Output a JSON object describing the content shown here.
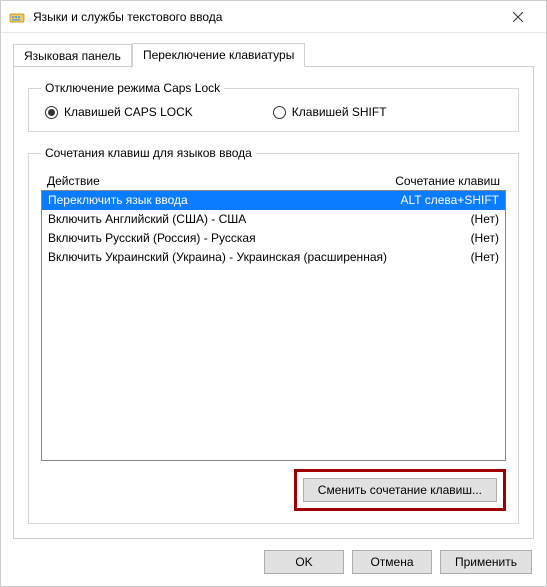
{
  "window": {
    "title": "Языки и службы текстового ввода"
  },
  "tabs": {
    "lang_panel": "Языковая панель",
    "kbd_switch": "Переключение клавиатуры"
  },
  "capslock_group": {
    "legend": "Отключение режима Caps Lock",
    "opt_caps": "Клавишей CAPS LOCK",
    "opt_shift": "Клавишей SHIFT"
  },
  "hotkeys_group": {
    "legend": "Сочетания клавиш для языков ввода",
    "col_action": "Действие",
    "col_combo": "Сочетание клавиш",
    "rows": [
      {
        "action": "Переключить язык ввода",
        "combo": "ALT слева+SHIFT",
        "selected": true
      },
      {
        "action": "Включить Английский (США) - США",
        "combo": "(Нет)",
        "selected": false
      },
      {
        "action": "Включить Русский (Россия) - Русская",
        "combo": "(Нет)",
        "selected": false
      },
      {
        "action": "Включить Украинский (Украина) - Украинская (расширенная)",
        "combo": "(Нет)",
        "selected": false
      }
    ],
    "change_btn": "Сменить сочетание клавиш..."
  },
  "footer": {
    "ok": "OK",
    "cancel": "Отмена",
    "apply": "Применить"
  }
}
